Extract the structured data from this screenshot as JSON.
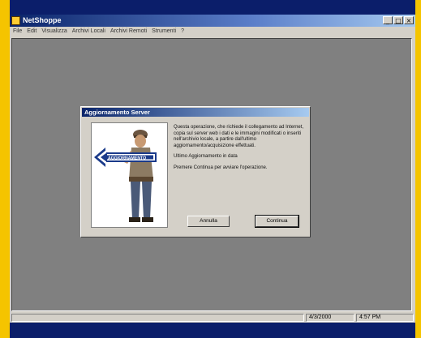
{
  "window": {
    "title": "NetShoppe"
  },
  "window_controls": {
    "minimize": "_",
    "maximize": "□",
    "close": "×"
  },
  "menu": [
    "File",
    "Edit",
    "Visualizza",
    "Archivi Locali",
    "Archivi Remoti",
    "Strumenti",
    "?"
  ],
  "dialog": {
    "title": "Aggiornamento Server",
    "sign_text": "AGGIORNAMENTO",
    "paragraph1": "Questa operazione, che richiede il collegamento ad Internet, copia sul server web i dati e le immagini modificati o inseriti nell'archivio locale, a partire dall'ultimo aggiornamento/acquisizione effettuati.",
    "paragraph2": "Ultimo Aggiornamento in data",
    "paragraph3": "Premere Continua per avviare l'operazione.",
    "cancel_label": "Annulla",
    "continue_label": "Continua"
  },
  "status": {
    "date": "4/3/2000",
    "time": "4:57 PM"
  },
  "colors": {
    "frame": "#f5c400",
    "background": "#0b1e6a",
    "workspace": "#808080",
    "chrome": "#d4d0c8"
  }
}
